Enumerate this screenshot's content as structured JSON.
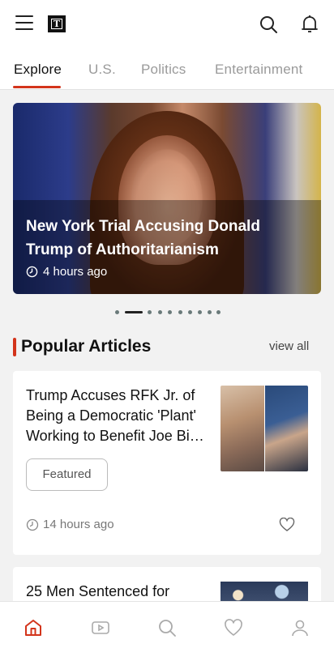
{
  "header": {
    "logo_letter": "T",
    "icons": [
      "menu-icon",
      "search-icon",
      "bell-icon"
    ]
  },
  "tabs": [
    {
      "label": "Explore",
      "active": true
    },
    {
      "label": "U.S.",
      "active": false
    },
    {
      "label": "Politics",
      "active": false
    },
    {
      "label": "Entertainment",
      "active": false
    }
  ],
  "hero": {
    "title": "New York Trial Accusing Donald Trump of Authoritarianism",
    "time": "4 hours ago",
    "slide_count": 10,
    "active_slide": 1
  },
  "popular": {
    "title": "Popular Articles",
    "view_all": "view all",
    "articles": [
      {
        "headline": "Trump Accuses RFK Jr. of Being a Democratic 'Plant' Working to Benefit Joe Bi…",
        "badge": "Featured",
        "time": "14 hours ago"
      },
      {
        "headline": "25 Men Sentenced for"
      }
    ]
  },
  "bottom_nav": [
    "home-icon",
    "video-icon",
    "search-icon",
    "heart-icon",
    "profile-icon"
  ],
  "colors": {
    "accent": "#d3341b",
    "background": "#f2f2f2"
  }
}
